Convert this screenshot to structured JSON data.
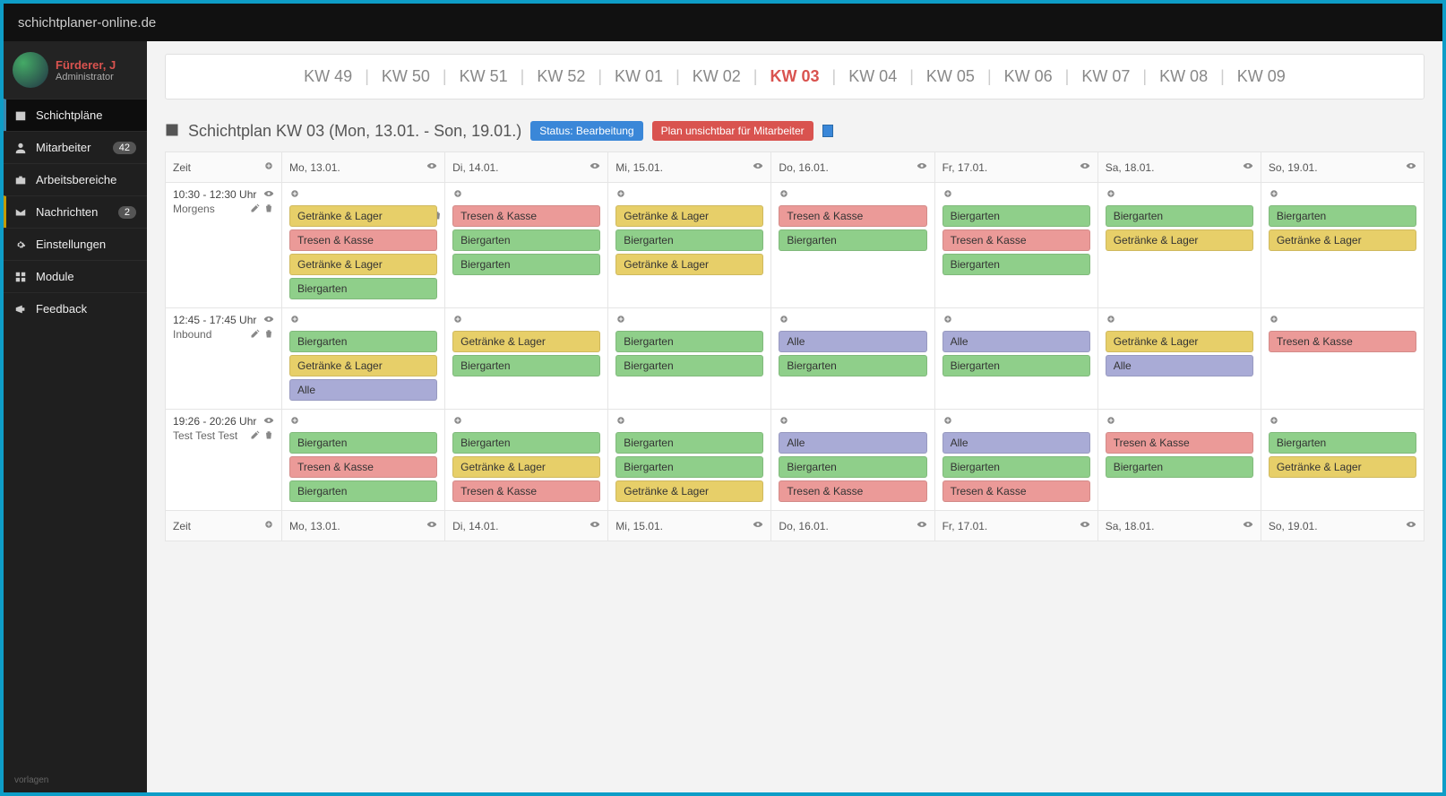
{
  "site_title": "schichtplaner-online.de",
  "user": {
    "name": "Fürderer, J",
    "role": "Administrator"
  },
  "nav": [
    {
      "icon": "calendar",
      "label": "Schichtpläne",
      "active": true
    },
    {
      "icon": "user",
      "label": "Mitarbeiter",
      "badge": "42"
    },
    {
      "icon": "briefcase",
      "label": "Arbeitsbereiche"
    },
    {
      "icon": "mail",
      "label": "Nachrichten",
      "badge": "2",
      "alt": true
    },
    {
      "icon": "gear",
      "label": "Einstellungen"
    },
    {
      "icon": "grid",
      "label": "Module"
    },
    {
      "icon": "bullhorn",
      "label": "Feedback"
    }
  ],
  "footer_text": "vorlagen",
  "weeks": [
    {
      "label": "KW 49"
    },
    {
      "label": "KW 50"
    },
    {
      "label": "KW 51"
    },
    {
      "label": "KW 52"
    },
    {
      "label": "KW 01"
    },
    {
      "label": "KW 02"
    },
    {
      "label": "KW 03",
      "active": true
    },
    {
      "label": "KW 04"
    },
    {
      "label": "KW 05"
    },
    {
      "label": "KW 06"
    },
    {
      "label": "KW 07"
    },
    {
      "label": "KW 08"
    },
    {
      "label": "KW 09"
    }
  ],
  "plan": {
    "title": "Schichtplan KW 03 (Mon, 13.01. - Son, 19.01.)",
    "status_label": "Status: Bearbeitung",
    "visibility_label": "Plan unsichtbar für Mitarbeiter"
  },
  "columns": {
    "zeit": "Zeit",
    "days": [
      "Mo, 13.01.",
      "Di, 14.01.",
      "Mi, 15.01.",
      "Do, 16.01.",
      "Fr, 17.01.",
      "Sa, 18.01.",
      "So, 19.01."
    ]
  },
  "slots": [
    {
      "time": "10:30 - 12:30 Uhr",
      "name": "Morgens",
      "days": [
        [
          {
            "t": "Getränke & Lager",
            "c": "yellow"
          },
          {
            "t": "Tresen & Kasse",
            "c": "red"
          },
          {
            "t": "Getränke & Lager",
            "c": "yellow"
          },
          {
            "t": "Biergarten",
            "c": "green"
          }
        ],
        [
          {
            "t": "Tresen & Kasse",
            "c": "red"
          },
          {
            "t": "Biergarten",
            "c": "green"
          },
          {
            "t": "Biergarten",
            "c": "green"
          }
        ],
        [
          {
            "t": "Getränke & Lager",
            "c": "yellow"
          },
          {
            "t": "Biergarten",
            "c": "green"
          },
          {
            "t": "Getränke & Lager",
            "c": "yellow"
          }
        ],
        [
          {
            "t": "Tresen & Kasse",
            "c": "red"
          },
          {
            "t": "Biergarten",
            "c": "green"
          }
        ],
        [
          {
            "t": "Biergarten",
            "c": "green"
          },
          {
            "t": "Tresen & Kasse",
            "c": "red"
          },
          {
            "t": "Biergarten",
            "c": "green"
          }
        ],
        [
          {
            "t": "Biergarten",
            "c": "green"
          },
          {
            "t": "Getränke & Lager",
            "c": "yellow"
          }
        ],
        [
          {
            "t": "Biergarten",
            "c": "green"
          },
          {
            "t": "Getränke & Lager",
            "c": "yellow"
          }
        ]
      ]
    },
    {
      "time": "12:45 - 17:45 Uhr",
      "name": "Inbound",
      "days": [
        [
          {
            "t": "Biergarten",
            "c": "green"
          },
          {
            "t": "Getränke & Lager",
            "c": "yellow"
          },
          {
            "t": "Alle",
            "c": "purple"
          }
        ],
        [
          {
            "t": "Getränke & Lager",
            "c": "yellow"
          },
          {
            "t": "Biergarten",
            "c": "green"
          }
        ],
        [
          {
            "t": "Biergarten",
            "c": "green"
          },
          {
            "t": "Biergarten",
            "c": "green"
          }
        ],
        [
          {
            "t": "Alle",
            "c": "purple"
          },
          {
            "t": "Biergarten",
            "c": "green"
          }
        ],
        [
          {
            "t": "Alle",
            "c": "purple"
          },
          {
            "t": "Biergarten",
            "c": "green"
          }
        ],
        [
          {
            "t": "Getränke & Lager",
            "c": "yellow"
          },
          {
            "t": "Alle",
            "c": "purple"
          }
        ],
        [
          {
            "t": "Tresen & Kasse",
            "c": "red"
          }
        ]
      ]
    },
    {
      "time": "19:26 - 20:26 Uhr",
      "name": "Test Test Test",
      "days": [
        [
          {
            "t": "Biergarten",
            "c": "green"
          },
          {
            "t": "Tresen & Kasse",
            "c": "red"
          },
          {
            "t": "Biergarten",
            "c": "green"
          }
        ],
        [
          {
            "t": "Biergarten",
            "c": "green"
          },
          {
            "t": "Getränke & Lager",
            "c": "yellow"
          },
          {
            "t": "Tresen & Kasse",
            "c": "red"
          }
        ],
        [
          {
            "t": "Biergarten",
            "c": "green"
          },
          {
            "t": "Biergarten",
            "c": "green"
          },
          {
            "t": "Getränke & Lager",
            "c": "yellow"
          }
        ],
        [
          {
            "t": "Alle",
            "c": "purple"
          },
          {
            "t": "Biergarten",
            "c": "green"
          },
          {
            "t": "Tresen & Kasse",
            "c": "red"
          }
        ],
        [
          {
            "t": "Alle",
            "c": "purple"
          },
          {
            "t": "Biergarten",
            "c": "green"
          },
          {
            "t": "Tresen & Kasse",
            "c": "red"
          }
        ],
        [
          {
            "t": "Tresen & Kasse",
            "c": "red"
          },
          {
            "t": "Biergarten",
            "c": "green"
          }
        ],
        [
          {
            "t": "Biergarten",
            "c": "green"
          },
          {
            "t": "Getränke & Lager",
            "c": "yellow"
          }
        ]
      ]
    }
  ]
}
